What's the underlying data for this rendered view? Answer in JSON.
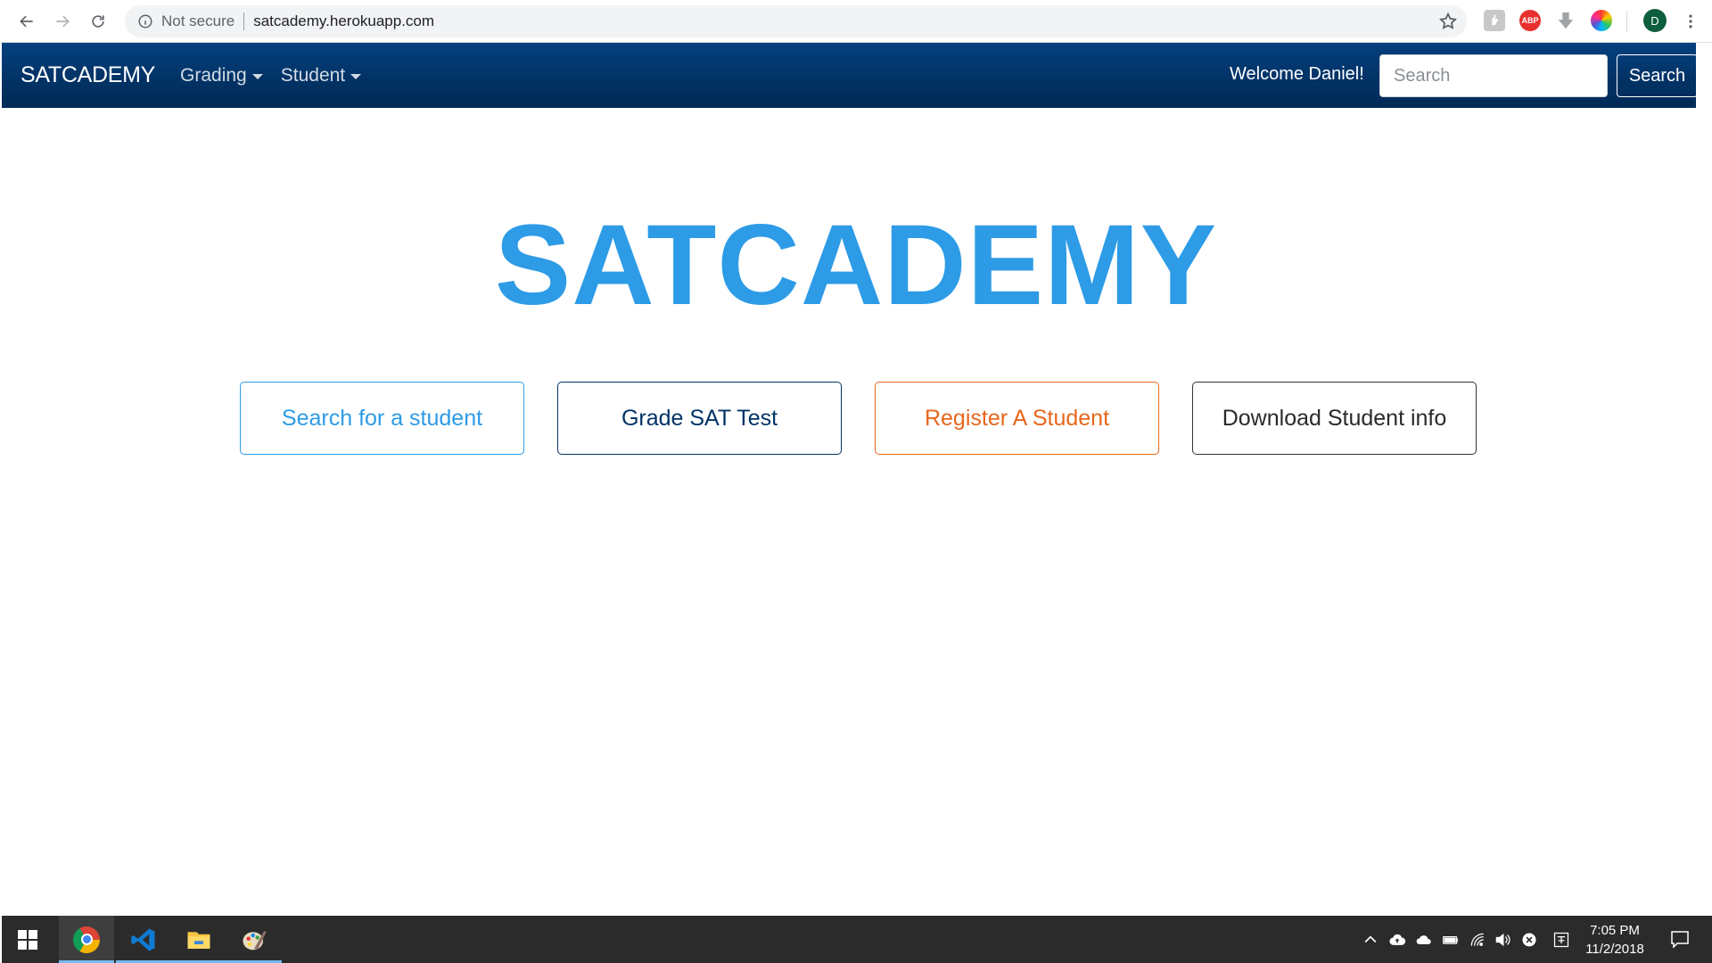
{
  "browser": {
    "security_label": "Not secure",
    "url": "satcademy.herokuapp.com",
    "profile_initial": "D",
    "extensions": [
      {
        "name": "adblock-extension-icon",
        "label": "ABP"
      }
    ]
  },
  "navbar": {
    "brand": "SATCADEMY",
    "menus": [
      {
        "label": "Grading"
      },
      {
        "label": "Student"
      }
    ],
    "welcome": "Welcome Daniel!",
    "search_placeholder": "Search",
    "search_button": "Search"
  },
  "main": {
    "title": "SATCADEMY",
    "actions": [
      {
        "label": "Search for a student",
        "color": "#2d9be6"
      },
      {
        "label": "Grade SAT Test",
        "color": "#023366"
      },
      {
        "label": "Register A Student",
        "color": "#e8661c"
      },
      {
        "label": "Download Student info",
        "color": "#2a2a2a"
      }
    ]
  },
  "taskbar": {
    "apps": [
      "chrome-icon",
      "vscode-icon",
      "file-explorer-icon",
      "paint-icon"
    ],
    "time": "7:05 PM",
    "date": "11/2/2018"
  },
  "colors": {
    "navbar": "#023366",
    "accent": "#2d9be6"
  }
}
